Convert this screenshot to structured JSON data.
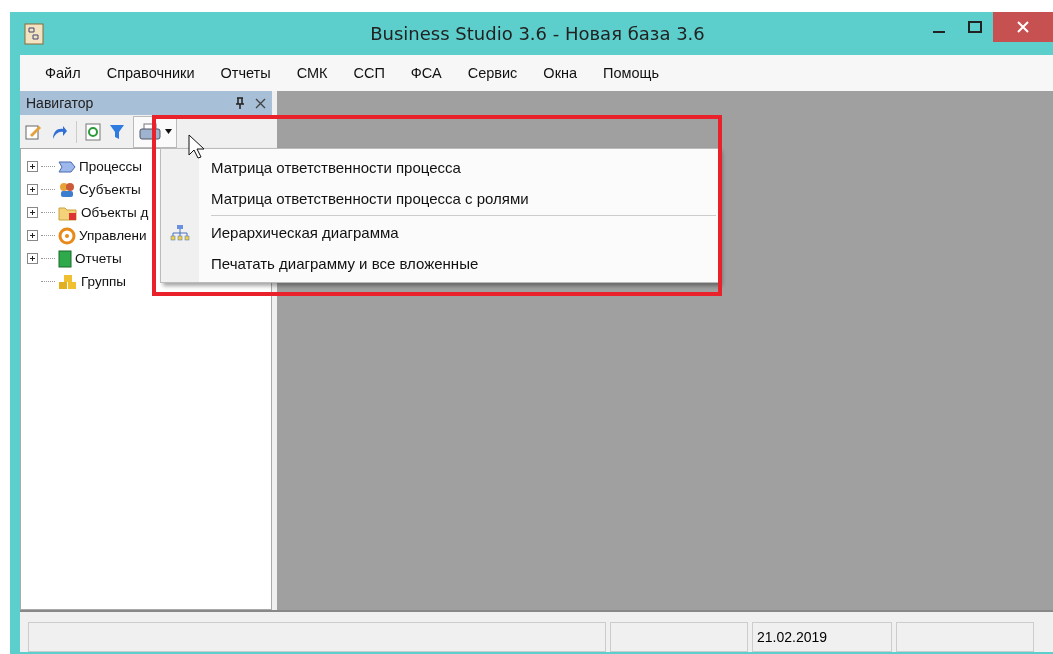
{
  "window": {
    "title": "Business Studio 3.6 - Новая база 3.6"
  },
  "menu_bar": [
    "Файл",
    "Справочники",
    "Отчеты",
    "СМК",
    "ССП",
    "ФСА",
    "Сервис",
    "Окна",
    "Помощь"
  ],
  "navigator": {
    "title": "Навигатор",
    "tree": [
      {
        "label": "Процессы",
        "expandable": true
      },
      {
        "label": "Субъекты",
        "expandable": true
      },
      {
        "label": "Объекты д",
        "expandable": true
      },
      {
        "label": "Управлени",
        "expandable": true
      },
      {
        "label": "Отчеты",
        "expandable": true
      },
      {
        "label": "Группы",
        "expandable": false
      }
    ]
  },
  "print_menu": {
    "items": [
      {
        "kind": "plain",
        "label": "Матрица ответственности процесса"
      },
      {
        "kind": "plain",
        "label": "Матрица ответственности процесса с ролями"
      },
      {
        "kind": "separator"
      },
      {
        "kind": "icon",
        "label": "Иерархическая диаграмма"
      },
      {
        "kind": "plain",
        "label": "Печатать диаграмму и все вложенные"
      }
    ]
  },
  "status_bar": {
    "date": "21.02.2019"
  }
}
